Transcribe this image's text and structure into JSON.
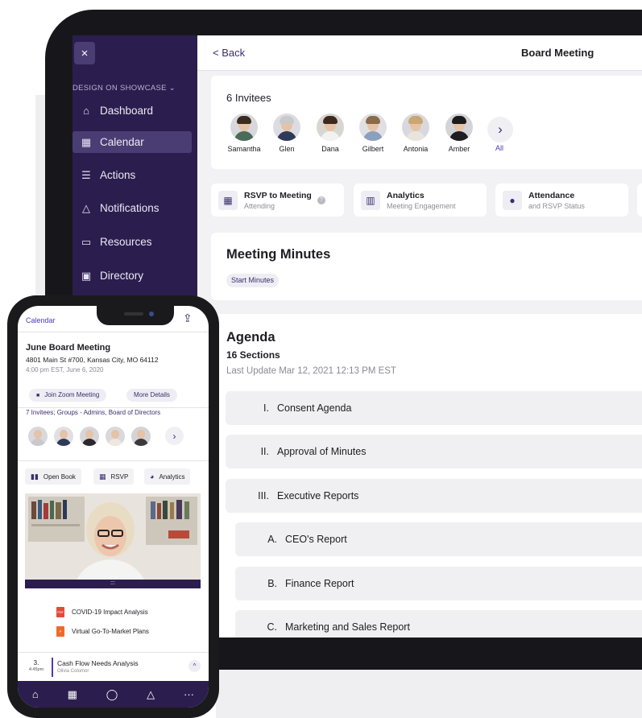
{
  "tablet": {
    "close_label": "×",
    "sidebar": {
      "org": "DESIGN ON SHOWCASE ⌄",
      "items": [
        {
          "label": "Dashboard",
          "icon": "⌂",
          "icon_name": "home-icon"
        },
        {
          "label": "Calendar",
          "icon": "▦",
          "icon_name": "calendar-icon",
          "active": true
        },
        {
          "label": "Actions",
          "icon": "☰",
          "icon_name": "actions-icon"
        },
        {
          "label": "Notifications",
          "icon": "△",
          "icon_name": "warning-icon"
        },
        {
          "label": "Resources",
          "icon": "▭",
          "icon_name": "folder-icon"
        },
        {
          "label": "Directory",
          "icon": "▣",
          "icon_name": "directory-icon"
        }
      ]
    },
    "header": {
      "back": "< Back",
      "title": "Board Meeting"
    },
    "invitees": {
      "title": "6 Invitees",
      "people": [
        {
          "name": "Samantha",
          "torso": "#4b6a5a",
          "hair": "#3a2a20",
          "bg": "#d8d8dc"
        },
        {
          "name": "Glen",
          "torso": "#2f3a58",
          "hair": "#c9c9c9",
          "bg": "#dcdde2"
        },
        {
          "name": "Dana",
          "torso": "#f2f2f2",
          "hair": "#3d2a1d",
          "bg": "#d9d6d1"
        },
        {
          "name": "Gilbert",
          "torso": "#8aa0bc",
          "hair": "#8a6a48",
          "bg": "#e0e0e4"
        },
        {
          "name": "Antonia",
          "torso": "#e9e4dd",
          "hair": "#c9a673",
          "bg": "#d9d9dd"
        },
        {
          "name": "Amber",
          "torso": "#1e1e22",
          "hair": "#1b1b1b",
          "bg": "#d4d4d8"
        }
      ],
      "next": "›",
      "all": "All"
    },
    "quick_actions": [
      {
        "title": "RSVP to Meeting",
        "sub": "Attending",
        "icon": "▦",
        "icon_name": "rsvp-calendar-icon"
      },
      {
        "title": "Analytics",
        "sub": "Meeting Engagement",
        "icon": "▥",
        "icon_name": "analytics-icon"
      },
      {
        "title": "Attendance",
        "sub": "and RSVP Status",
        "icon": "●",
        "icon_name": "attendance-icon"
      }
    ],
    "help": "?",
    "minutes": {
      "title": "Meeting Minutes",
      "button": "Start Minutes"
    },
    "agenda": {
      "title": "Agenda",
      "sections": "16 Sections",
      "updated": "Last Update Mar 12, 2021 12:13 PM EST",
      "items": [
        {
          "num": "I.",
          "label": "Consent Agenda",
          "indent": 0
        },
        {
          "num": "II.",
          "label": "Approval of Minutes",
          "indent": 0
        },
        {
          "num": "III.",
          "label": "Executive Reports",
          "indent": 0
        },
        {
          "num": "A.",
          "label": "CEO's Report",
          "indent": 1
        },
        {
          "num": "B.",
          "label": "Finance Report",
          "indent": 1
        },
        {
          "num": "C.",
          "label": "Marketing and Sales Report",
          "indent": 1
        }
      ]
    }
  },
  "phone": {
    "back": "Calendar",
    "share": "⇪",
    "title": "June Board Meeting",
    "address": "4801 Main St #700, Kansas City, MO 64112",
    "time": "4:00 pm EST,  June 6, 2020",
    "zoom_icon": "■",
    "zoom_label": "Join Zoom Meeting",
    "more": "More Details",
    "invitees_text": "7 Invitees; Groups - Admins, Board of Directors",
    "avatars": [
      {
        "torso": "#c9c9cc",
        "bg": "#d9d9dd"
      },
      {
        "torso": "#2f3a58",
        "bg": "#e0e0e4"
      },
      {
        "torso": "#2a2a2e",
        "bg": "#d6d6da"
      },
      {
        "torso": "#eee7de",
        "bg": "#d9d9dd"
      },
      {
        "torso": "#3a3a3e",
        "bg": "#d4d4d8"
      }
    ],
    "next": "›",
    "buttons": [
      {
        "label": "Open Book",
        "icon": "▮▮",
        "icon_name": "book-icon"
      },
      {
        "label": "RSVP",
        "icon": "▦",
        "icon_name": "rsvp-icon"
      },
      {
        "label": "Analytics",
        "icon": "◕",
        "icon_name": "pie-chart-icon"
      }
    ],
    "video_handle": ":::",
    "docs": [
      {
        "label": "COVID-19 Impact Analysis",
        "type": "PDF"
      },
      {
        "label": "Virtual Go-To-Market Plans",
        "type": "P"
      }
    ],
    "agenda_item": {
      "num": "3.",
      "time": "4:45pm",
      "title": "Cash Flow Needs Analysis",
      "sub": "Olivia Colomor",
      "up": "^"
    },
    "nav": [
      {
        "icon": "⌂",
        "name": "home-nav-icon"
      },
      {
        "icon": "▦",
        "name": "calendar-nav-icon"
      },
      {
        "icon": "◯",
        "name": "chat-nav-icon"
      },
      {
        "icon": "△",
        "name": "alert-nav-icon"
      },
      {
        "icon": "···",
        "name": "more-nav-icon"
      }
    ]
  }
}
